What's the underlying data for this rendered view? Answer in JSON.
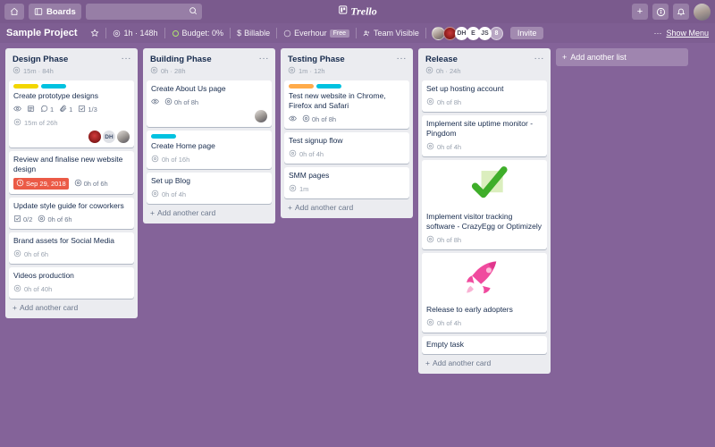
{
  "topnav": {
    "home_icon": "home-icon",
    "boards_label": "Boards",
    "search_placeholder": "",
    "search_icon": "search-icon",
    "logo_text": "Trello",
    "add_label": "+",
    "info_label": "?",
    "bell_icon": "notification-bell-icon"
  },
  "boardbar": {
    "title": "Sample Project",
    "star_icon": "star-icon",
    "time_tracked": "1h · 148h",
    "budget": "Budget: 0%",
    "billable": "Billable",
    "billable_symbol": "$",
    "everhour": "Everhour",
    "everhour_plan": "Free",
    "visibility": "Team Visible",
    "members": [
      {
        "label": "",
        "kind": "photo"
      },
      {
        "label": "",
        "kind": "photo2"
      },
      {
        "label": "DH",
        "kind": "initials"
      },
      {
        "label": "E",
        "kind": "initials"
      },
      {
        "label": "JS",
        "kind": "initials"
      },
      {
        "label": "8",
        "kind": "more"
      }
    ],
    "invite_label": "Invite",
    "show_menu_label": "Show Menu",
    "show_menu_dots": "···"
  },
  "add_list": {
    "label": "Add another list",
    "plus": "+"
  },
  "lists": [
    {
      "title": "Design Phase",
      "time": "15m · 84h",
      "dots": "···",
      "add_card": "Add another card",
      "cards": [
        {
          "title": "Create prototype designs",
          "labels": [
            "#f2d600",
            "#00c2e0"
          ],
          "badges": [
            {
              "type": "watch",
              "text": ""
            },
            {
              "type": "description",
              "text": ""
            },
            {
              "type": "comment",
              "text": "1"
            },
            {
              "type": "attachment",
              "text": "1"
            },
            {
              "type": "checklist",
              "text": "1/3"
            }
          ],
          "time": "15m of 26h",
          "avatars": [
            {
              "label": "",
              "kind": "red"
            },
            {
              "label": "DH",
              "kind": "initials"
            },
            {
              "label": "",
              "kind": "photo"
            }
          ]
        },
        {
          "title": "Review and finalise new website design",
          "labels": [],
          "badges": [
            {
              "type": "due",
              "text": "Sep 29, 2018"
            },
            {
              "type": "time",
              "text": "0h of 6h"
            }
          ],
          "time": "",
          "avatars": []
        },
        {
          "title": "Update style guide for coworkers",
          "labels": [],
          "badges": [
            {
              "type": "checklist",
              "text": "0/2"
            },
            {
              "type": "time",
              "text": "0h of 6h"
            }
          ],
          "time": "",
          "avatars": []
        },
        {
          "title": "Brand assets for Social Media",
          "labels": [],
          "badges": [],
          "time": "0h of 6h",
          "avatars": []
        },
        {
          "title": "Videos production",
          "labels": [],
          "badges": [],
          "time": "0h of 40h",
          "avatars": []
        }
      ]
    },
    {
      "title": "Building Phase",
      "time": "0h · 28h",
      "dots": "···",
      "add_card": "Add another card",
      "cards": [
        {
          "title": "Create About Us page",
          "labels": [],
          "badges": [
            {
              "type": "watch",
              "text": ""
            },
            {
              "type": "time",
              "text": "0h of 8h"
            }
          ],
          "time": "",
          "avatars": [
            {
              "label": "",
              "kind": "photo"
            }
          ]
        },
        {
          "title": "Create Home page",
          "labels": [
            "#00c2e0"
          ],
          "badges": [],
          "time": "0h of 16h",
          "avatars": []
        },
        {
          "title": "Set up Blog",
          "labels": [],
          "badges": [],
          "time": "0h of 4h",
          "avatars": []
        }
      ]
    },
    {
      "title": "Testing Phase",
      "time": "1m · 12h",
      "dots": "···",
      "add_card": "Add another card",
      "cards": [
        {
          "title": "Test new website in Chrome, Firefox and Safari",
          "labels": [
            "#ffab4a",
            "#00c2e0"
          ],
          "badges": [
            {
              "type": "watch",
              "text": ""
            },
            {
              "type": "time",
              "text": "0h of 8h"
            }
          ],
          "time": "",
          "avatars": []
        },
        {
          "title": "Test signup flow",
          "labels": [],
          "badges": [],
          "time": "0h of 4h",
          "avatars": []
        },
        {
          "title": "SMM pages",
          "labels": [],
          "badges": [],
          "time": "1m",
          "avatars": []
        }
      ]
    },
    {
      "title": "Release",
      "time": "0h · 24h",
      "dots": "···",
      "add_card": "Add another card",
      "cards": [
        {
          "title": "Set up hosting account",
          "labels": [],
          "badges": [],
          "time": "0h of 8h",
          "avatars": []
        },
        {
          "title": "Implement site uptime monitor - Pingdom",
          "labels": [],
          "badges": [],
          "time": "0h of 4h",
          "avatars": []
        },
        {
          "title": "Implement visitor tracking software - CrazyEgg or Optimizely",
          "labels": [],
          "cover": "green-checkmark-image",
          "badges": [],
          "time": "0h of 8h",
          "avatars": []
        },
        {
          "title": "Release to early adopters",
          "labels": [],
          "cover": "pink-rocket-image",
          "badges": [],
          "time": "0h of 4h",
          "avatars": []
        },
        {
          "title": "Empty task",
          "labels": [],
          "badges": [],
          "time": "",
          "avatars": []
        }
      ]
    }
  ]
}
